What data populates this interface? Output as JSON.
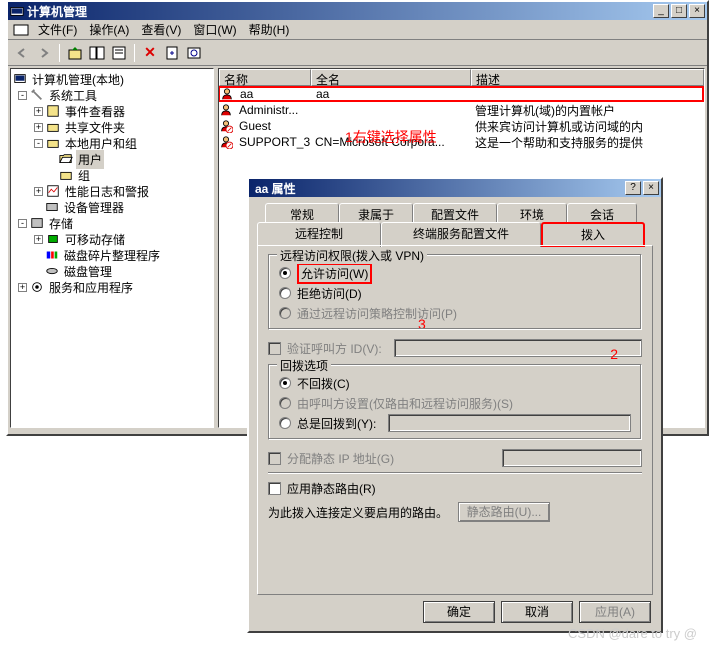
{
  "window": {
    "title": "计算机管理",
    "menu": {
      "file": "文件(F)",
      "action": "操作(A)",
      "view": "查看(V)",
      "window": "窗口(W)",
      "help": "帮助(H)"
    }
  },
  "tree": {
    "root": "计算机管理(本地)",
    "systools": "系统工具",
    "eventviewer": "事件查看器",
    "shared": "共享文件夹",
    "localusers": "本地用户和组",
    "users": "用户",
    "groups": "组",
    "perf": "性能日志和警报",
    "devmgr": "设备管理器",
    "storage": "存储",
    "removable": "可移动存储",
    "defrag": "磁盘碎片整理程序",
    "diskmgr": "磁盘管理",
    "services": "服务和应用程序"
  },
  "list": {
    "columns": {
      "name": "名称",
      "fullname": "全名",
      "desc": "描述"
    },
    "rows": [
      {
        "name": "aa",
        "fullname": "aa",
        "desc": ""
      },
      {
        "name": "Administr...",
        "fullname": "",
        "desc": "管理计算机(域)的内置帐户"
      },
      {
        "name": "Guest",
        "fullname": "",
        "desc": "供来宾访问计算机或访问域的内"
      },
      {
        "name": "SUPPORT_3...",
        "fullname": "CN=Microsoft Corpora...",
        "desc": "这是一个帮助和支持服务的提供"
      }
    ]
  },
  "annotations": {
    "a1": "1右键选择属性",
    "a2": "2",
    "a3": "3"
  },
  "dialog": {
    "title": "aa 属性",
    "tabs_row1": [
      "常规",
      "隶属于",
      "配置文件",
      "环境",
      "会话"
    ],
    "tabs_row2": [
      "远程控制",
      "终端服务配置文件",
      "拨入"
    ],
    "active_tab": "拨入",
    "group_remote": "远程访问权限(拨入或 VPN)",
    "radio_allow": "允许访问(W)",
    "radio_deny": "拒绝访问(D)",
    "radio_policy": "通过远程访问策略控制访问(P)",
    "check_verify": "验证呼叫方 ID(V):",
    "group_callback": "回拨选项",
    "radio_nocallback": "不回拨(C)",
    "radio_callerset": "由呼叫方设置(仅路由和远程访问服务)(S)",
    "radio_always": "总是回拨到(Y):",
    "check_staticip": "分配静态 IP 地址(G)",
    "check_staticroute": "应用静态路由(R)",
    "label_routes": "为此拨入连接定义要启用的路由。",
    "btn_routes": "静态路由(U)...",
    "btn_ok": "确定",
    "btn_cancel": "取消",
    "btn_apply": "应用(A)"
  },
  "watermark": "CSDN @dare to try @"
}
